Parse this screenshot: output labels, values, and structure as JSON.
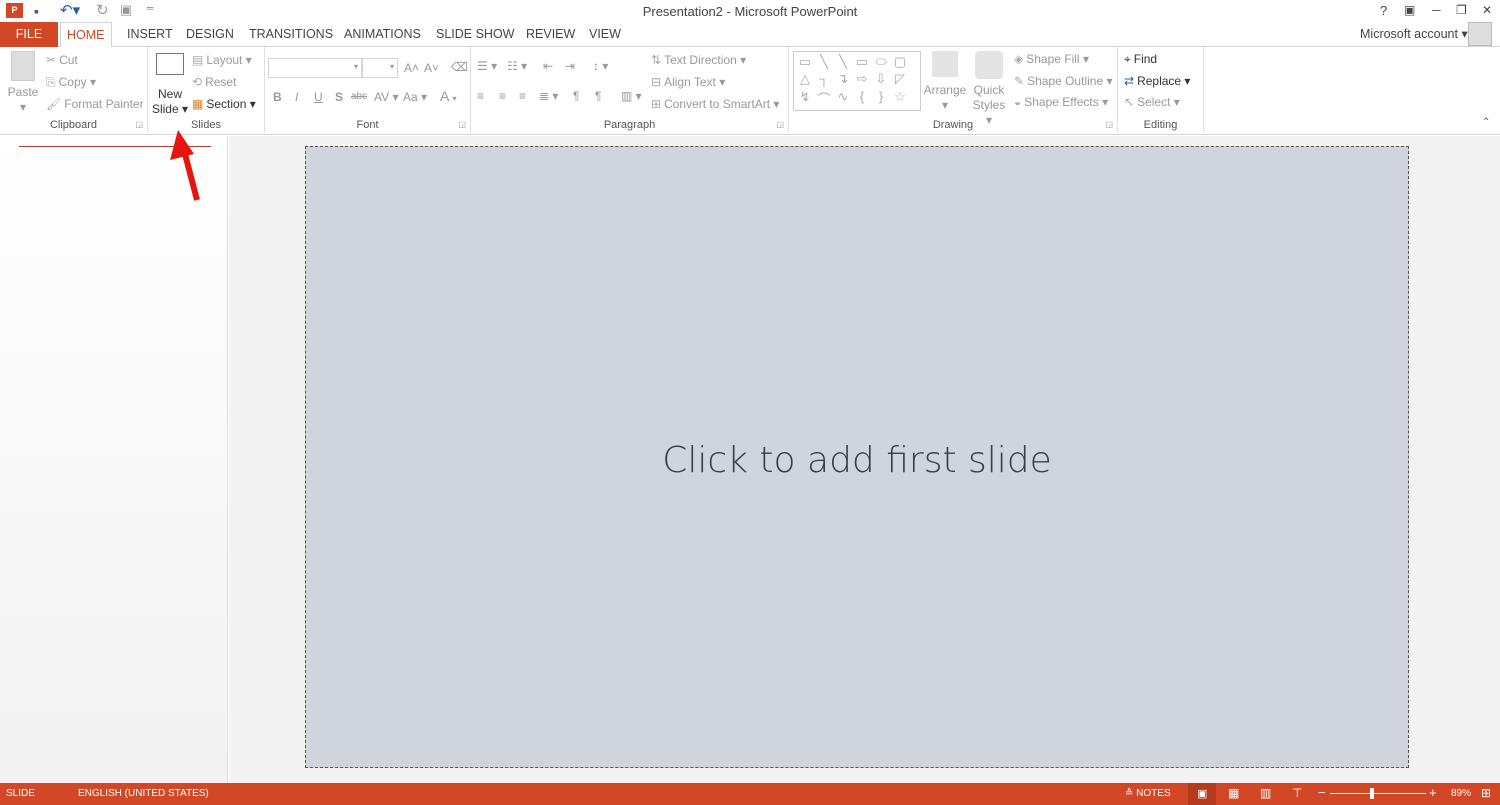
{
  "app": {
    "title": "Presentation2 - Microsoft PowerPoint",
    "account": "Microsoft account"
  },
  "quick_access": [
    "save-icon",
    "undo-icon",
    "redo-icon",
    "start-from-beginning-icon",
    "customize-icon"
  ],
  "window_controls": {
    "help": "?",
    "restore_ribbon": "▣",
    "minimize": "─",
    "restore": "❐",
    "close": "✕"
  },
  "tabs": [
    {
      "label": "FILE"
    },
    {
      "label": "HOME"
    },
    {
      "label": "INSERT"
    },
    {
      "label": "DESIGN"
    },
    {
      "label": "TRANSITIONS"
    },
    {
      "label": "ANIMATIONS"
    },
    {
      "label": "SLIDE SHOW"
    },
    {
      "label": "REVIEW"
    },
    {
      "label": "VIEW"
    }
  ],
  "ribbon": {
    "clipboard": {
      "label": "Clipboard",
      "paste": "Paste",
      "cut": "Cut",
      "copy": "Copy",
      "format_painter": "Format Painter"
    },
    "slides": {
      "label": "Slides",
      "new_slide_1": "New",
      "new_slide_2": "Slide",
      "layout": "Layout",
      "reset": "Reset",
      "section": "Section"
    },
    "font": {
      "label": "Font",
      "bold": "B",
      "italic": "I",
      "underline": "U",
      "shadow": "S",
      "strike": "abc",
      "spacing": "AV",
      "case": "Aa",
      "color": "A",
      "grow": "A˄",
      "shrink": "A˅"
    },
    "paragraph": {
      "label": "Paragraph",
      "text_direction": "Text Direction",
      "align_text": "Align Text",
      "smartart": "Convert to SmartArt"
    },
    "drawing": {
      "label": "Drawing",
      "shapes": [
        "▭",
        "╲",
        "╲",
        "▭",
        "⬭",
        "▢",
        "△",
        "┐",
        "↴",
        "⇨",
        "⇩",
        "◸",
        "↯",
        "⌒",
        "∿",
        "{",
        "}",
        "☆"
      ],
      "arrange": "Arrange",
      "quick_1": "Quick",
      "quick_2": "Styles",
      "shape_fill": "Shape Fill",
      "shape_outline": "Shape Outline",
      "shape_effects": "Shape Effects"
    },
    "editing": {
      "label": "Editing",
      "find": "Find",
      "replace": "Replace",
      "select": "Select"
    }
  },
  "slide": {
    "placeholder": "Click to add first slide"
  },
  "annotation": {
    "color": "#e8150e"
  },
  "status": {
    "slide": "SLIDE",
    "language": "ENGLISH (UNITED STATES)",
    "notes": "NOTES",
    "zoom": "89%",
    "zoom_percent": 89
  },
  "colors": {
    "accent": "#d24726",
    "slide_bg": "#d0d4dd"
  }
}
